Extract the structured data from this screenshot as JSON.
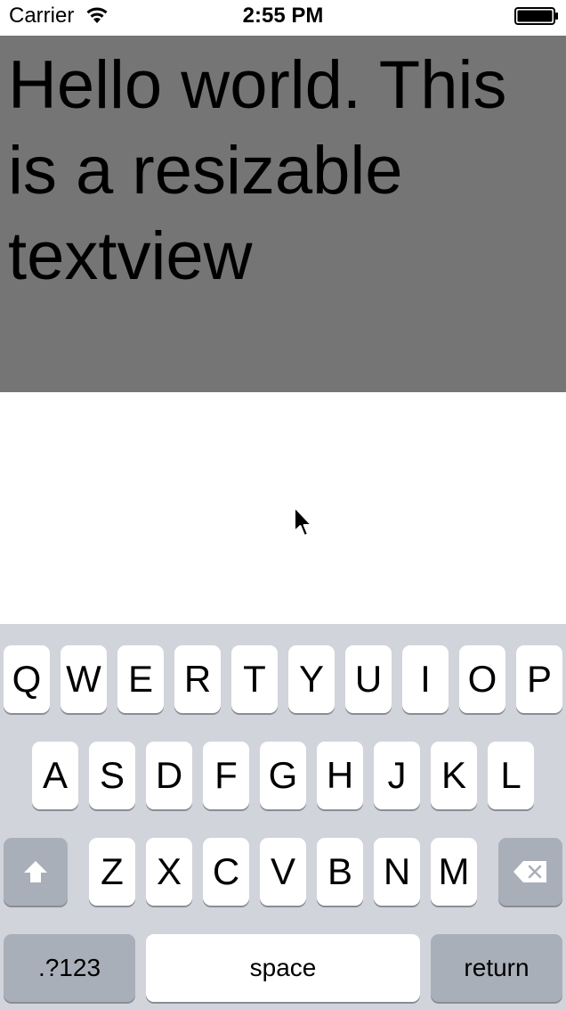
{
  "status_bar": {
    "carrier": "Carrier",
    "time": "2:55 PM",
    "wifi_icon": "wifi-icon",
    "battery_icon": "battery-icon"
  },
  "text_view": {
    "content": "Hello world. This is a resizable textview",
    "background_color": "#757575"
  },
  "keyboard": {
    "row1": [
      "Q",
      "W",
      "E",
      "R",
      "T",
      "Y",
      "U",
      "I",
      "O",
      "P"
    ],
    "row2": [
      "A",
      "S",
      "D",
      "F",
      "G",
      "H",
      "J",
      "K",
      "L"
    ],
    "row3": [
      "Z",
      "X",
      "C",
      "V",
      "B",
      "N",
      "M"
    ],
    "shift_icon": "shift-arrow-icon",
    "delete_icon": "delete-backspace-icon",
    "numbers_label": ".?123",
    "space_label": "space",
    "return_label": "return",
    "background_color": "#d1d4db"
  },
  "cursor_icon": "mouse-pointer-icon"
}
